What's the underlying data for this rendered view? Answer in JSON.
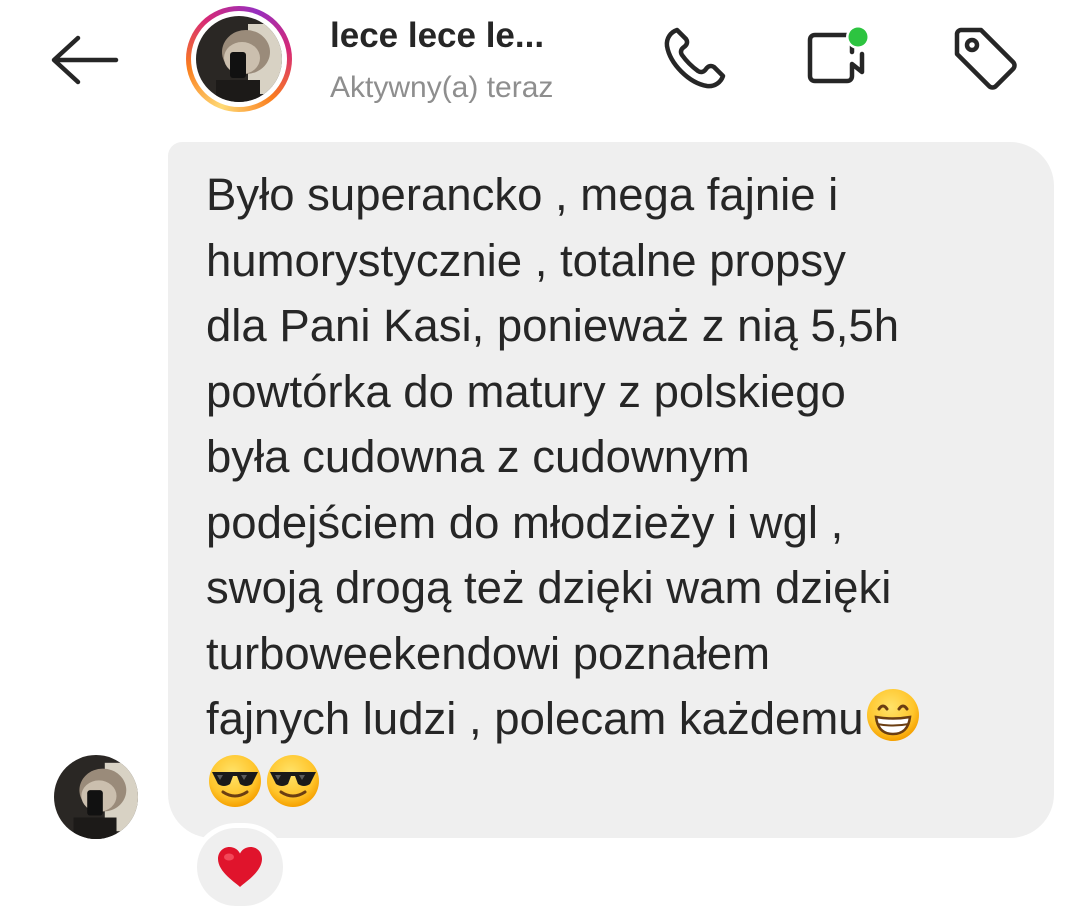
{
  "header": {
    "back_icon": "arrow-left-icon",
    "contact_name": "lece lece le...",
    "status": "Aktywny(a) teraz",
    "call_icon": "phone-icon",
    "video_icon": "video-camera-icon",
    "video_status_color": "#2dc440",
    "tag_icon": "tag-icon",
    "story_ring_colors": [
      "#feda75",
      "#fa7e1e",
      "#d62976",
      "#962fbf"
    ]
  },
  "message": {
    "lines": [
      "Było superancko , mega fajnie i",
      "humorystycznie , totalne propsy",
      "dla Pani Kasi, ponieważ z nią 5,5h",
      "powtórka do matury z polskiego",
      "była cudowna z cudownym",
      "podejściem do młodzieży i wgl ,",
      "swoją drogą też dzięki wam dzięki",
      "turboweekendowi poznałem",
      "fajnych ludzi , polecam każdemu"
    ],
    "emojis": [
      "grinning-face-icon",
      "sunglasses-face-icon",
      "sunglasses-face-icon"
    ],
    "bubble_color": "#efefef"
  },
  "reaction": {
    "icon": "red-heart-icon",
    "color": "#e0142c"
  }
}
